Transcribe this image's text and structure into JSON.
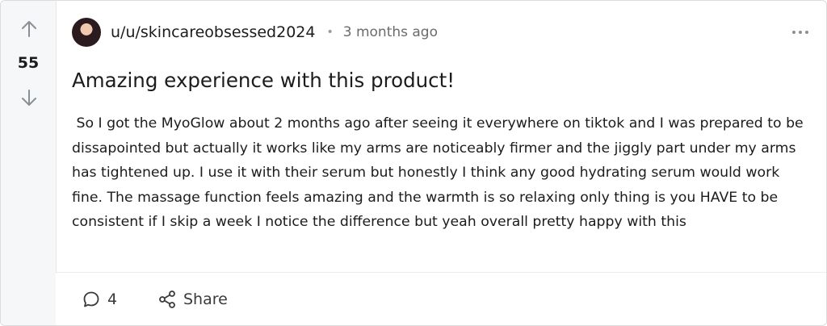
{
  "post": {
    "score": "55",
    "author": "u/u/skincareobsessed2024",
    "separator": "•",
    "time_ago": "3 months ago",
    "title": "Amazing experience with this product!",
    "body": " So I got the MyoGlow about 2 months ago after seeing it everywhere on tiktok and I was prepared to be dissapointed but actually it works like my arms are noticeably firmer and the jiggly part under my arms has tightened up. I use it with their serum but honestly I think any good hydrating serum would work fine. The massage function feels amazing and the warmth is so relaxing only thing is you HAVE to be consistent if I skip a week I notice the difference but yeah overall pretty happy with this"
  },
  "actions": {
    "comment_count": "4",
    "share_label": "Share"
  },
  "icons": {
    "upvote": "arrow-up-icon",
    "downvote": "arrow-down-icon",
    "more": "more-horizontal-icon",
    "comment": "comment-bubble-icon",
    "share": "share-icon"
  },
  "colors": {
    "vote_column_bg": "#f6f7f8",
    "text": "#1c1c1c",
    "muted": "#6b6b6b",
    "border": "#dcdcdc"
  }
}
